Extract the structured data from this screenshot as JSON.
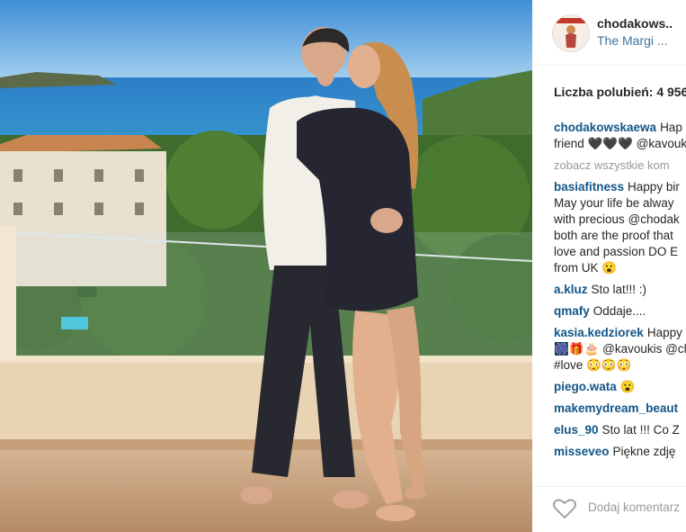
{
  "post": {
    "username": "chodakows..",
    "location": "The Margi ...",
    "likes_label": "Liczba polubień: 4 956",
    "comments": [
      {
        "user": "chodakowskaewa",
        "lines": [
          "Hap",
          "friend 🖤🖤🖤 @kavouki"
        ]
      },
      {
        "more": "zobacz wszystkie kom"
      },
      {
        "user": "basiafitness",
        "lines": [
          "Happy bir",
          "May your life be alway",
          "with precious @chodak",
          "both are the proof that",
          "love and passion DO E",
          "from UK 😮"
        ]
      },
      {
        "user": "a.kluz",
        "lines": [
          "Sto lat!!! :)"
        ]
      },
      {
        "user": "qmafy",
        "lines": [
          "Oddaje...."
        ]
      },
      {
        "user": "kasia.kedziorek",
        "lines": [
          "Happy",
          "🎆🎁🎂 @kavoukis @ch",
          "#love 😳😳😳"
        ]
      },
      {
        "user": "piego.wata",
        "lines": [
          "😮"
        ]
      },
      {
        "user": "makemydream_beaut",
        "lines": [
          ""
        ]
      },
      {
        "user": "elus_90",
        "lines": [
          "Sto lat !!! Co Z"
        ]
      },
      {
        "user": "misseveo",
        "lines": [
          "Piękne zdję"
        ]
      }
    ],
    "add_comment_placeholder": "Dodaj komentarz",
    "heart_icon": "heart-outline-icon"
  },
  "colors": {
    "username": "#125688",
    "location": "#3f729b",
    "muted": "#999999"
  }
}
